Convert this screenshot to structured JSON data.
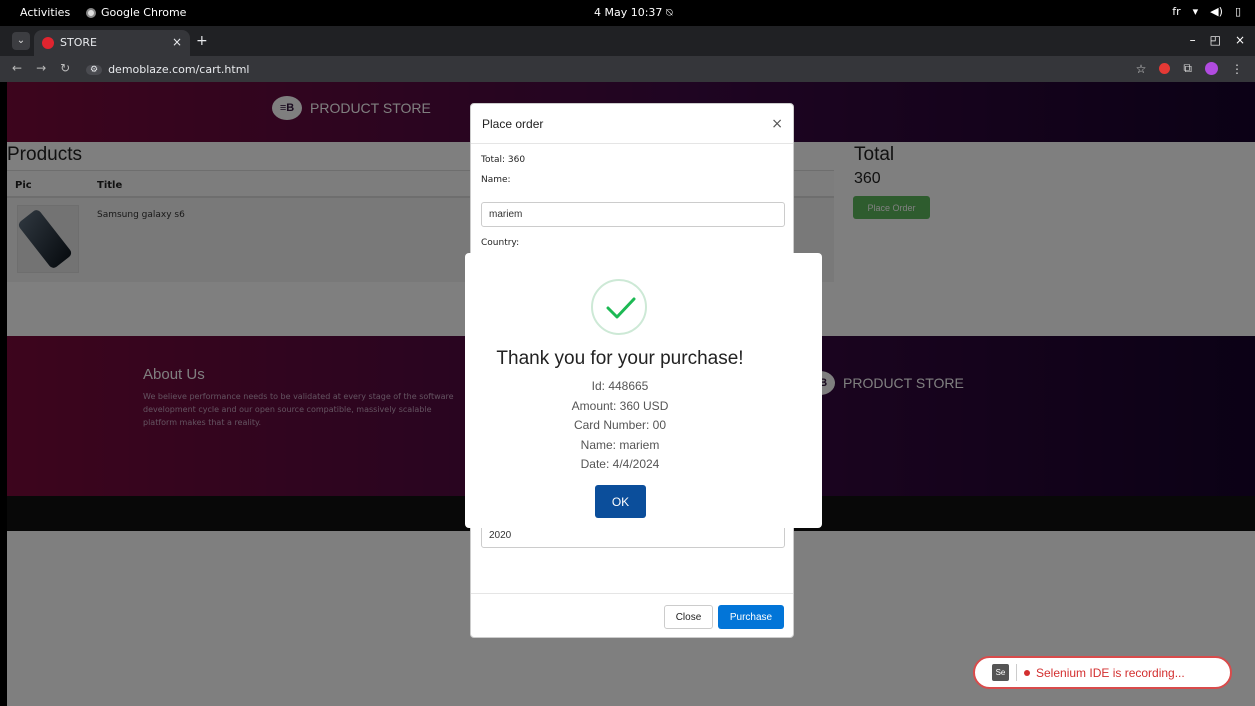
{
  "os_bar": {
    "activities": "Activities",
    "app": "Google Chrome",
    "clock": "4 May 10:37",
    "lang": "fr"
  },
  "browser": {
    "tab_title": "STORE",
    "url": "demoblaze.com/cart.html"
  },
  "page": {
    "brand": "PRODUCT STORE",
    "products_heading": "Products",
    "table_headers": [
      "Pic",
      "Title"
    ],
    "rows": [
      {
        "title": "Samsung galaxy s6"
      }
    ],
    "total_heading": "Total",
    "total_value": "360",
    "place_order_button": "Place Order",
    "about_heading": "About Us",
    "about_text": "We believe performance needs to be validated at every stage of the software development cycle and our open source compatible, massively scalable platform makes that a reality.",
    "footer_brand": "PRODUCT STORE"
  },
  "order_modal": {
    "title": "Place order",
    "total_label": "Total: 360",
    "name_label": "Name:",
    "name_value": "mariem",
    "country_label": "Country:",
    "year_value": "2020",
    "close_button": "Close",
    "purchase_button": "Purchase"
  },
  "alert": {
    "title": "Thank you for your purchase!",
    "id_line": "Id: 448665",
    "amount_line": "Amount: 360 USD",
    "card_line": "Card Number: 00",
    "name_line": "Name: mariem",
    "date_line": "Date: 4/4/2024",
    "ok_button": "OK",
    "check_color": "#1db954"
  },
  "selenium": {
    "logo_text": "Se",
    "status": "Selenium IDE is recording..."
  },
  "colors": {
    "navbar_start": "#7a0a3a",
    "navbar_end": "#17032c",
    "place_order_green": "#5cb85c",
    "purchase_blue": "#0275d8",
    "ok_blue": "#0b4e9b",
    "selenium_red": "#d32f2f"
  }
}
